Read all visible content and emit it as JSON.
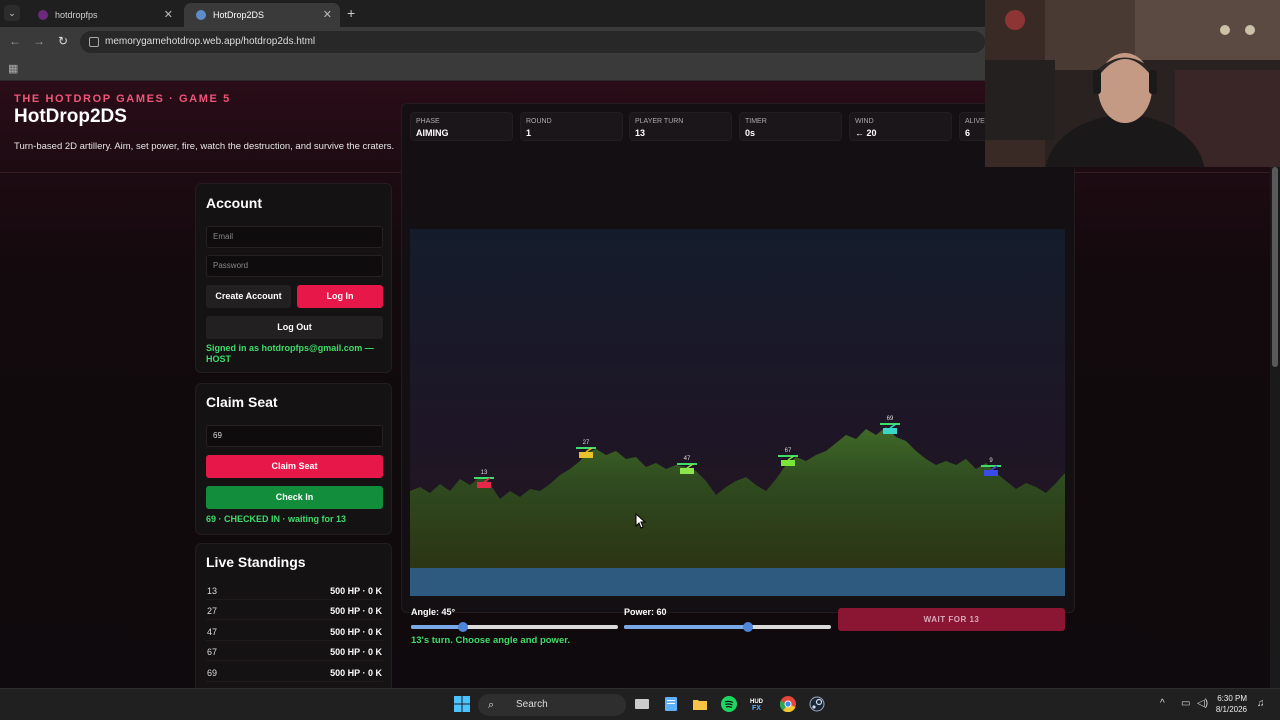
{
  "browser": {
    "tabs": [
      {
        "title": "hotdropfps",
        "active": false
      },
      {
        "title": "HotDrop2DS",
        "active": true
      }
    ],
    "url": "memorygamehotdrop.web.app/hotdrop2ds.html"
  },
  "header": {
    "kicker": "THE HOTDROP GAMES · GAME 5",
    "title": "HotDrop2DS",
    "tagline": "Turn-based 2D artillery. Aim, set power, fire, watch the destruction, and survive the craters."
  },
  "account": {
    "heading": "Account",
    "email_placeholder": "Email",
    "password_placeholder": "Password",
    "create_label": "Create Account",
    "login_label": "Log In",
    "logout_label": "Log Out",
    "status": "Signed in as hotdropfps@gmail.com — HOST"
  },
  "claim": {
    "heading": "Claim Seat",
    "seat_value": "69",
    "claim_label": "Claim Seat",
    "checkin_label": "Check In",
    "status": "69 · CHECKED IN · waiting for 13"
  },
  "standings": {
    "heading": "Live Standings",
    "rows": [
      {
        "id": "13",
        "stats": "500 HP · 0 K"
      },
      {
        "id": "27",
        "stats": "500 HP · 0 K"
      },
      {
        "id": "47",
        "stats": "500 HP · 0 K"
      },
      {
        "id": "67",
        "stats": "500 HP · 0 K"
      },
      {
        "id": "69",
        "stats": "500 HP · 0 K"
      }
    ]
  },
  "stats": [
    {
      "label": "PHASE",
      "value": "AIMING"
    },
    {
      "label": "ROUND",
      "value": "1"
    },
    {
      "label": "PLAYER TURN",
      "value": "13"
    },
    {
      "label": "TIMER",
      "value": "0s"
    },
    {
      "label": "WIND",
      "value": "← 20"
    },
    {
      "label": "ALIVE",
      "value": "6"
    }
  ],
  "tanks": [
    {
      "id": "13",
      "color": "#e8284a"
    },
    {
      "id": "27",
      "color": "#e8c22a"
    },
    {
      "id": "47",
      "color": "#8ae64a"
    },
    {
      "id": "67",
      "color": "#7ae63a"
    },
    {
      "id": "69",
      "color": "#3ad6c8"
    },
    {
      "id": "9",
      "color": "#3a4ae6"
    }
  ],
  "controls": {
    "angle_label": "Angle: 45°",
    "angle_value": 45,
    "angle_max": 180,
    "power_label": "Power: 60",
    "power_value": 60,
    "power_max": 100,
    "fire_label": "WAIT FOR 13",
    "turn_message": "13's turn. Choose angle and power."
  },
  "taskbar": {
    "search_label": "Search",
    "time": "6:30 PM",
    "date": "8/1/2026"
  }
}
